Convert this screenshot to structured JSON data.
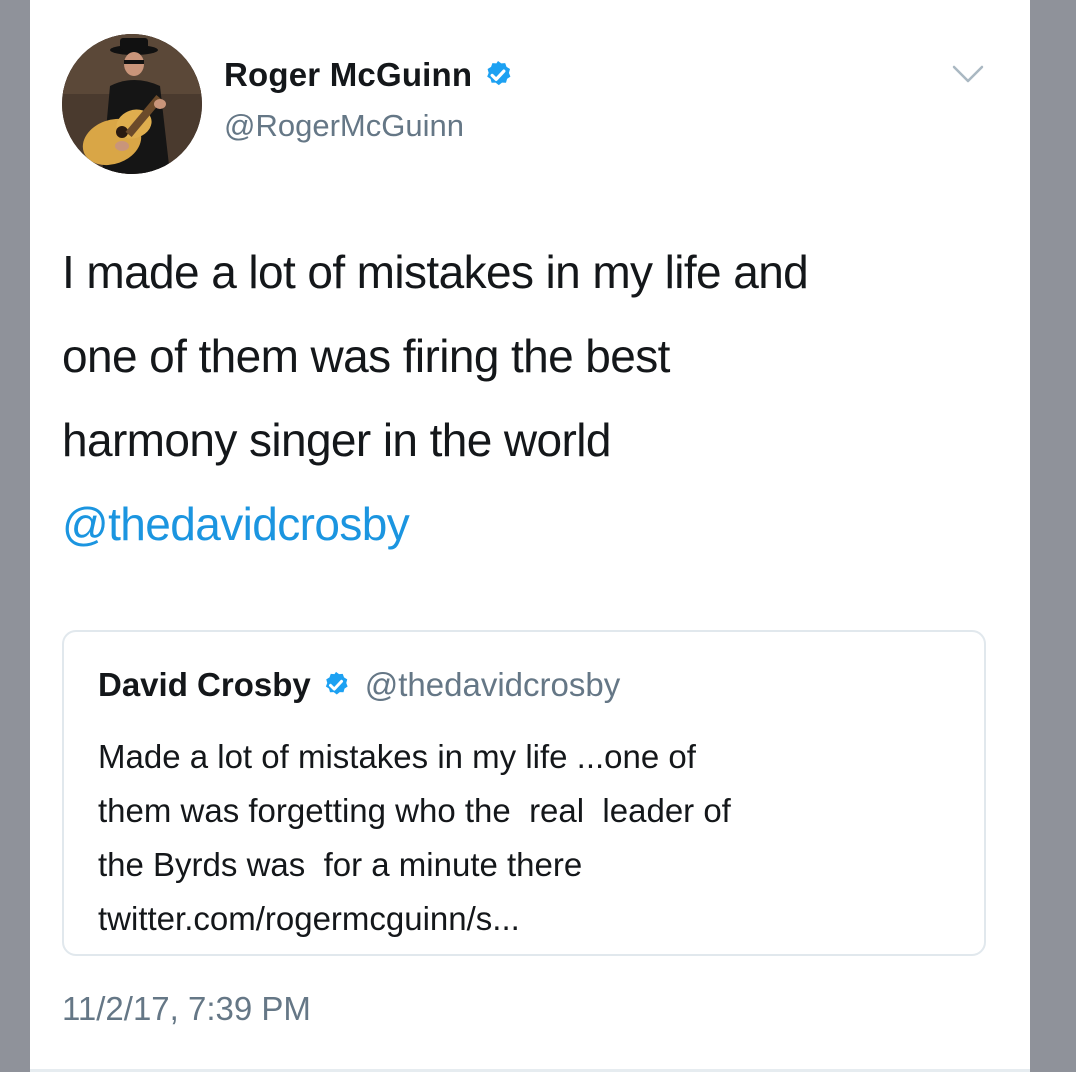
{
  "tweet": {
    "author_name": "Roger McGuinn",
    "author_handle": "@RogerMcGuinn",
    "text_lines": [
      "I made a lot of mistakes in my life and",
      "one of them was firing the best",
      "harmony singer in the world"
    ],
    "mention": "@thedavidcrosby",
    "timestamp": "11/2/17, 7:39 PM"
  },
  "quoted_tweet": {
    "author_name": "David Crosby",
    "author_handle": "@thedavidcrosby",
    "text_lines": [
      "Made a lot of mistakes in my life ...one of",
      "them was forgetting who the  real  leader of",
      "the Byrds was  for a minute there",
      "twitter.com/rogermcguinn/s..."
    ]
  },
  "icons": {
    "verified": "verified-badge-icon",
    "caret": "chevron-down-icon"
  },
  "colors": {
    "link": "#1b95e0",
    "verified": "#1da1f2",
    "secondary_text": "#657786"
  }
}
